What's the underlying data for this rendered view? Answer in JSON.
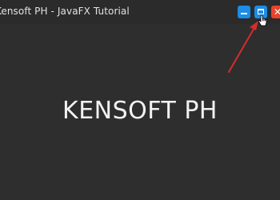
{
  "window": {
    "title": "Kensoft PH - JavaFX Tutorial",
    "minimize_icon": "minimize-icon",
    "maximize_icon": "maximize-icon",
    "close_icon": "close-icon",
    "close_glyph": "✕",
    "accent_color": "#1c8ce6",
    "close_color": "#e8432d"
  },
  "content": {
    "label": "KENSOFT PH"
  },
  "annotation": {
    "arrow_color": "#d62c2c"
  }
}
